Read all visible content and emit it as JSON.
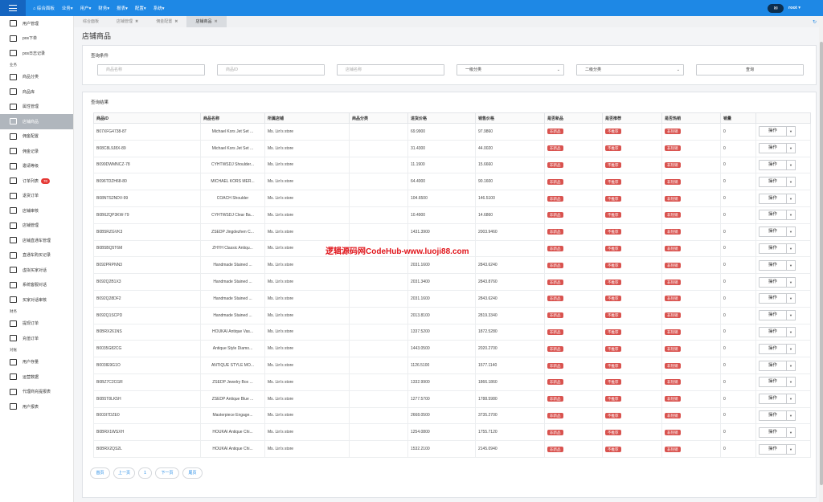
{
  "topnav": {
    "items": [
      "⌂ 综合面板",
      "业务▾",
      "用户▾",
      "财务▾",
      "报表▾",
      "配置▾",
      "系统▾"
    ],
    "user": "root ▾",
    "chat_icon": "chat-bubble-icon"
  },
  "sidebar": {
    "entries": [
      {
        "type": "item",
        "label": "用户管理",
        "icon": "file-icon"
      },
      {
        "type": "item",
        "label": "pos下单",
        "icon": "columns-icon"
      },
      {
        "type": "item",
        "label": "pos日志记录",
        "icon": "columns-icon"
      },
      {
        "type": "group",
        "label": "业务"
      },
      {
        "type": "item",
        "label": "商品分类",
        "icon": "laptop-icon"
      },
      {
        "type": "item",
        "label": "商品库",
        "icon": "columns-icon"
      },
      {
        "type": "item",
        "label": "属性管理",
        "icon": "file-icon"
      },
      {
        "type": "item",
        "label": "店铺商品",
        "icon": "columns-icon",
        "active": true
      },
      {
        "type": "item",
        "label": "佣金配置",
        "icon": "columns-icon"
      },
      {
        "type": "item",
        "label": "佣金记录",
        "icon": "columns-icon"
      },
      {
        "type": "item",
        "label": "邀请等级",
        "icon": "keyboard-icon"
      },
      {
        "type": "item",
        "label": "订单列表",
        "icon": "pencil-icon",
        "badge": "70"
      },
      {
        "type": "item",
        "label": "退货订单",
        "icon": "pencil-icon"
      },
      {
        "type": "item",
        "label": "店铺审核",
        "icon": "card-icon"
      },
      {
        "type": "item",
        "label": "店铺管理",
        "icon": "card-icon"
      },
      {
        "type": "item",
        "label": "店铺直通车管理",
        "icon": "card-icon"
      },
      {
        "type": "item",
        "label": "直通车购买记录",
        "icon": "card-icon"
      },
      {
        "type": "item",
        "label": "虚拟买家对话",
        "icon": "card-icon"
      },
      {
        "type": "item",
        "label": "系统客服对话",
        "icon": "card-icon"
      },
      {
        "type": "item",
        "label": "买家对话审核",
        "icon": "card-icon"
      },
      {
        "type": "group",
        "label": "财务"
      },
      {
        "type": "item",
        "label": "提现订单",
        "icon": "card-icon"
      },
      {
        "type": "item",
        "label": "充值订单",
        "icon": "card-icon"
      },
      {
        "type": "group",
        "label": "对账"
      },
      {
        "type": "item",
        "label": "用户存量",
        "icon": "pie-chart-icon"
      },
      {
        "type": "item",
        "label": "运营数据",
        "icon": "pie-chart-icon"
      },
      {
        "type": "item",
        "label": "代理商充提报表",
        "icon": "sitemap-icon"
      },
      {
        "type": "item",
        "label": "用户报表",
        "icon": "list-icon"
      }
    ]
  },
  "tabs": [
    {
      "label": "综合面板",
      "closable": false
    },
    {
      "label": "店铺管理",
      "closable": true
    },
    {
      "label": "佣金配置",
      "closable": true
    },
    {
      "label": "店铺商品",
      "closable": true,
      "active": true
    }
  ],
  "page_title": "店铺商品",
  "query": {
    "title": "查询条件",
    "product_name_placeholder": "商品名称",
    "product_id_placeholder": "商品ID",
    "store_name_placeholder": "店铺名称",
    "category1": "一级分类",
    "category2": "二级分类",
    "search_label": "查询"
  },
  "results": {
    "title": "查询结果",
    "columns": [
      "商品ID",
      "商品名称",
      "所属店铺",
      "商品分类",
      "进货价格",
      "销售价格",
      "是否新品",
      "是否推荐",
      "是否热销",
      "销量",
      ""
    ],
    "op_label": "操作",
    "rows": [
      [
        "B07XFG4738-87",
        "Michael Kors Jet Set ...",
        "Ms. Lin's store",
        "",
        "69.9900",
        "97.9860",
        "非新品",
        "不推荐",
        "非热销",
        "0"
      ],
      [
        "B08C8L9J8X-89",
        "Michael Kors Jet Set ...",
        "Ms. Lin's store",
        "",
        "31.4300",
        "44.0020",
        "非新品",
        "不推荐",
        "非热销",
        "0"
      ],
      [
        "B099DWMNCZ-78",
        "CYHTWSDJ Shoulder...",
        "Ms. Lin's store",
        "",
        "11.1900",
        "15.6660",
        "非新品",
        "不推荐",
        "非热销",
        "0"
      ],
      [
        "B096TDZH68-80",
        "MICHAEL KORS MER...",
        "Ms. Lin's store",
        "",
        "64.4000",
        "90.1600",
        "非新品",
        "不推荐",
        "非热销",
        "0"
      ],
      [
        "B08NTS2NDV-99",
        "COACH Shoulder",
        "Ms. Lin's store",
        "",
        "104.6500",
        "146.5100",
        "非新品",
        "不推荐",
        "非热销",
        "0"
      ],
      [
        "B0B6ZQP3KW-79",
        "CYHTWSDJ Clear Ba...",
        "Ms. Lin's store",
        "",
        "10.4900",
        "14.6860",
        "非新品",
        "不推荐",
        "非热销",
        "0"
      ],
      [
        "B0B5RZGVK3",
        "ZSEDP Jingdezhen C...",
        "Ms. Lin's store",
        "",
        "1431.3900",
        "2003.9460",
        "非新品",
        "不推荐",
        "非热销",
        "0"
      ],
      [
        "B0B5BQ5T6M",
        "ZHYH Classic Antiqu...",
        "Ms. Lin's store",
        "",
        "",
        "",
        "非新品",
        "不推荐",
        "非热销",
        "0"
      ],
      [
        "B092PRPNN3",
        "Handmade Stained ...",
        "Ms. Lin's store",
        "",
        "2031.1600",
        "2843.6240",
        "非新品",
        "不推荐",
        "非热销",
        "0"
      ],
      [
        "B092Q2B1X3",
        "Handmade Stained ...",
        "Ms. Lin's store",
        "",
        "2031.3400",
        "2843.8760",
        "非新品",
        "不推荐",
        "非热销",
        "0"
      ],
      [
        "B092Q28DF2",
        "Handmade Stained ...",
        "Ms. Lin's store",
        "",
        "2031.1600",
        "2843.6240",
        "非新品",
        "不推荐",
        "非热销",
        "0"
      ],
      [
        "B092Q1SCPD",
        "Handmade Stained ...",
        "Ms. Lin's store",
        "",
        "2013.8100",
        "2819.3340",
        "非新品",
        "不推荐",
        "非热销",
        "0"
      ],
      [
        "B0BRX261NS",
        "HOUKAI Antique Vas...",
        "Ms. Lin's store",
        "",
        "1337.5200",
        "1872.5280",
        "非新品",
        "不推荐",
        "非热销",
        "0"
      ],
      [
        "B0035G82CG",
        "Antique Style Diamo...",
        "Ms. Lin's store",
        "",
        "1443.0500",
        "2020.2700",
        "非新品",
        "不推荐",
        "非热销",
        "0"
      ],
      [
        "B003IE9G1O",
        "ANTIQUE STYLE MO...",
        "Ms. Lin's store",
        "",
        "1126.5100",
        "1577.1140",
        "非新品",
        "不推荐",
        "非热销",
        "0"
      ],
      [
        "B0BZ7C2CGR",
        "ZSEDP Jewelry Box ...",
        "Ms. Lin's store",
        "",
        "1332.9900",
        "1866.1860",
        "非新品",
        "不推荐",
        "非热销",
        "0"
      ],
      [
        "B0B5T8LK5H",
        "ZSEDP Antique Blue ...",
        "Ms. Lin's store",
        "",
        "1277.5700",
        "1788.5980",
        "非新品",
        "不推荐",
        "非热销",
        "0"
      ],
      [
        "B003I7DZE0",
        "Masterpiece Engage...",
        "Ms. Lin's store",
        "",
        "2668.0500",
        "3735.2700",
        "非新品",
        "不推荐",
        "非热销",
        "0"
      ],
      [
        "B0BRX1WSXH",
        "HOUKAI Antique Chi...",
        "Ms. Lin's store",
        "",
        "1254.0800",
        "1755.7120",
        "非新品",
        "不推荐",
        "非热销",
        "0"
      ],
      [
        "B0BRX2QS2L",
        "HOUKAI Antique Chi...",
        "Ms. Lin's store",
        "",
        "1532.2100",
        "2145.0940",
        "非新品",
        "不推荐",
        "非热销",
        "0"
      ]
    ]
  },
  "pager": {
    "first": "首页",
    "prev": "上一页",
    "current": "1",
    "next": "下一页",
    "last": "尾页"
  },
  "watermark": "逻辑源码网CodeHub-www.luoji88.com",
  "colors": {
    "topbar": "#1e88e5",
    "accent": "#1e88e5",
    "tag": "#d9534f",
    "badge": "#e53935"
  }
}
